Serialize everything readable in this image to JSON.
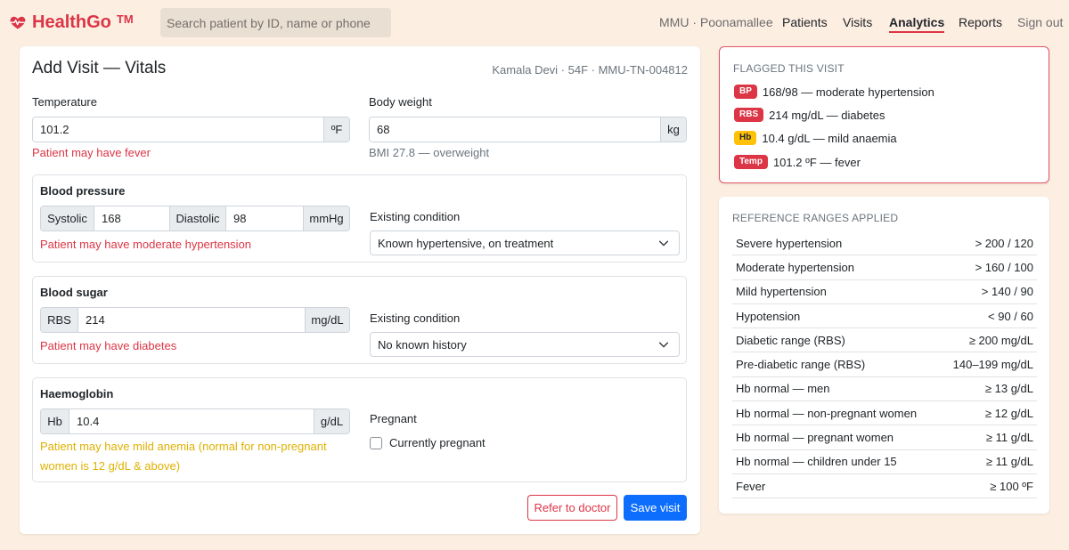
{
  "brand": {
    "name": "HealthGo",
    "tm": "TM",
    "color": "#dc3545"
  },
  "search": {
    "placeholder": "Search patient by ID, name or phone"
  },
  "nav": {
    "unit": "MMU · Poonamallee",
    "links": [
      "Patients",
      "Visits",
      "Analytics",
      "Reports"
    ],
    "active": "Analytics",
    "signout": "Sign out"
  },
  "form": {
    "title": "Add Visit — Vitals",
    "patient": "Kamala Devi · 54F · MMU-TN-004812",
    "temperature": {
      "label": "Temperature",
      "value": "101.2",
      "unit": "ºF",
      "message": "Patient may have fever"
    },
    "weight": {
      "label": "Body weight",
      "value": "68",
      "unit": "kg",
      "message": "BMI 27.8 — overweight"
    },
    "bp": {
      "title": "Blood pressure",
      "systolic_label": "Systolic",
      "systolic": "168",
      "diastolic_label": "Diastolic",
      "diastolic": "98",
      "unit": "mmHg",
      "message": "Patient may have moderate hypertension",
      "condition_label": "Existing condition",
      "condition": "Known hypertensive, on treatment"
    },
    "sugar": {
      "title": "Blood sugar",
      "label": "RBS",
      "value": "214",
      "unit": "mg/dL",
      "message": "Patient may have diabetes",
      "condition_label": "Existing condition",
      "condition": "No known history"
    },
    "hb": {
      "title": "Haemoglobin",
      "label": "Hb",
      "value": "10.4",
      "unit": "g/dL",
      "message_line1": "Patient may have mild anemia (normal for non-pregnant",
      "message_line2": "women is 12 g/dL & above)",
      "pregnant_label": "Pregnant",
      "pregnant_checkbox": "Currently pregnant",
      "pregnant": false
    },
    "buttons": {
      "refer": "Refer to doctor",
      "save": "Save visit"
    }
  },
  "flagged": {
    "heading": "FLAGGED THIS VISIT",
    "items": [
      {
        "badge": "BP",
        "text": "168/98 — moderate hypertension",
        "color": "red"
      },
      {
        "badge": "RBS",
        "text": "214 mg/dL — diabetes",
        "color": "red"
      },
      {
        "badge": "Hb",
        "text": "10.4 g/dL — mild anaemia",
        "color": "yellow"
      },
      {
        "badge": "Temp",
        "text": "101.2 ºF — fever",
        "color": "red"
      }
    ]
  },
  "reference": {
    "heading": "REFERENCE RANGES APPLIED",
    "rows": [
      {
        "name": "Severe hypertension",
        "range": "> 200 / 120"
      },
      {
        "name": "Moderate hypertension",
        "range": "> 160 / 100"
      },
      {
        "name": "Mild hypertension",
        "range": "> 140 / 90"
      },
      {
        "name": "Hypotension",
        "range": "< 90 / 60"
      },
      {
        "name": "Diabetic range (RBS)",
        "range": "≥ 200 mg/dL"
      },
      {
        "name": "Pre-diabetic range (RBS)",
        "range": "140–199 mg/dL"
      },
      {
        "name": "Hb normal — men",
        "range": "≥ 13 g/dL"
      },
      {
        "name": "Hb normal — non-pregnant women",
        "range": "≥ 12 g/dL"
      },
      {
        "name": "Hb normal — pregnant women",
        "range": "≥ 11 g/dL"
      },
      {
        "name": "Hb normal — children under 15",
        "range": "≥ 11 g/dL"
      },
      {
        "name": "Fever",
        "range": "≥ 100 ºF"
      }
    ]
  },
  "colors": {
    "danger": "#dc3545",
    "primary": "#0d6efd",
    "warning": "#ffc107",
    "background": "#fdeee2"
  }
}
